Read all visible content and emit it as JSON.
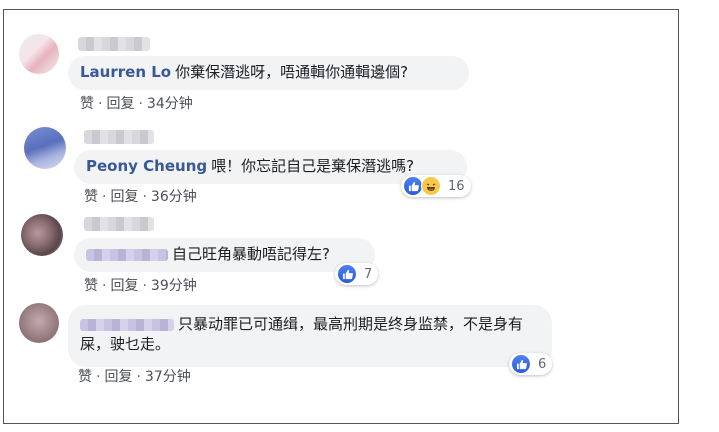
{
  "comments": [
    {
      "author": "Laurren Lo",
      "text": "你棄保潛逃呀，唔通輯你通輯邊個?",
      "actions": {
        "like": "赞",
        "reply": "回复",
        "time": "34分钟"
      },
      "reactions": null
    },
    {
      "author": "Peony Cheung",
      "text": "喂！你忘記自己是棄保潛逃嗎?",
      "actions": {
        "like": "赞",
        "reply": "回复",
        "time": "36分钟"
      },
      "reactions": {
        "count": "16",
        "icons": [
          "like-icon",
          "haha-icon"
        ]
      }
    },
    {
      "author": "",
      "text": "自己旺角暴動唔記得左?",
      "actions": {
        "like": "赞",
        "reply": "回复",
        "time": "39分钟"
      },
      "reactions": {
        "count": "7",
        "icons": [
          "like-icon"
        ]
      }
    },
    {
      "author": "",
      "text": "只暴动罪已可通缉，最高刑期是终身监禁，不是身有屎，驶乜走。",
      "actions": {
        "like": "赞",
        "reply": "回复",
        "time": "37分钟"
      },
      "reactions": {
        "count": "6",
        "icons": [
          "like-icon"
        ]
      }
    }
  ],
  "colors": {
    "author": "#385898",
    "bubble": "#f2f3f5",
    "like": "#2a5cd8"
  },
  "separator": "·"
}
